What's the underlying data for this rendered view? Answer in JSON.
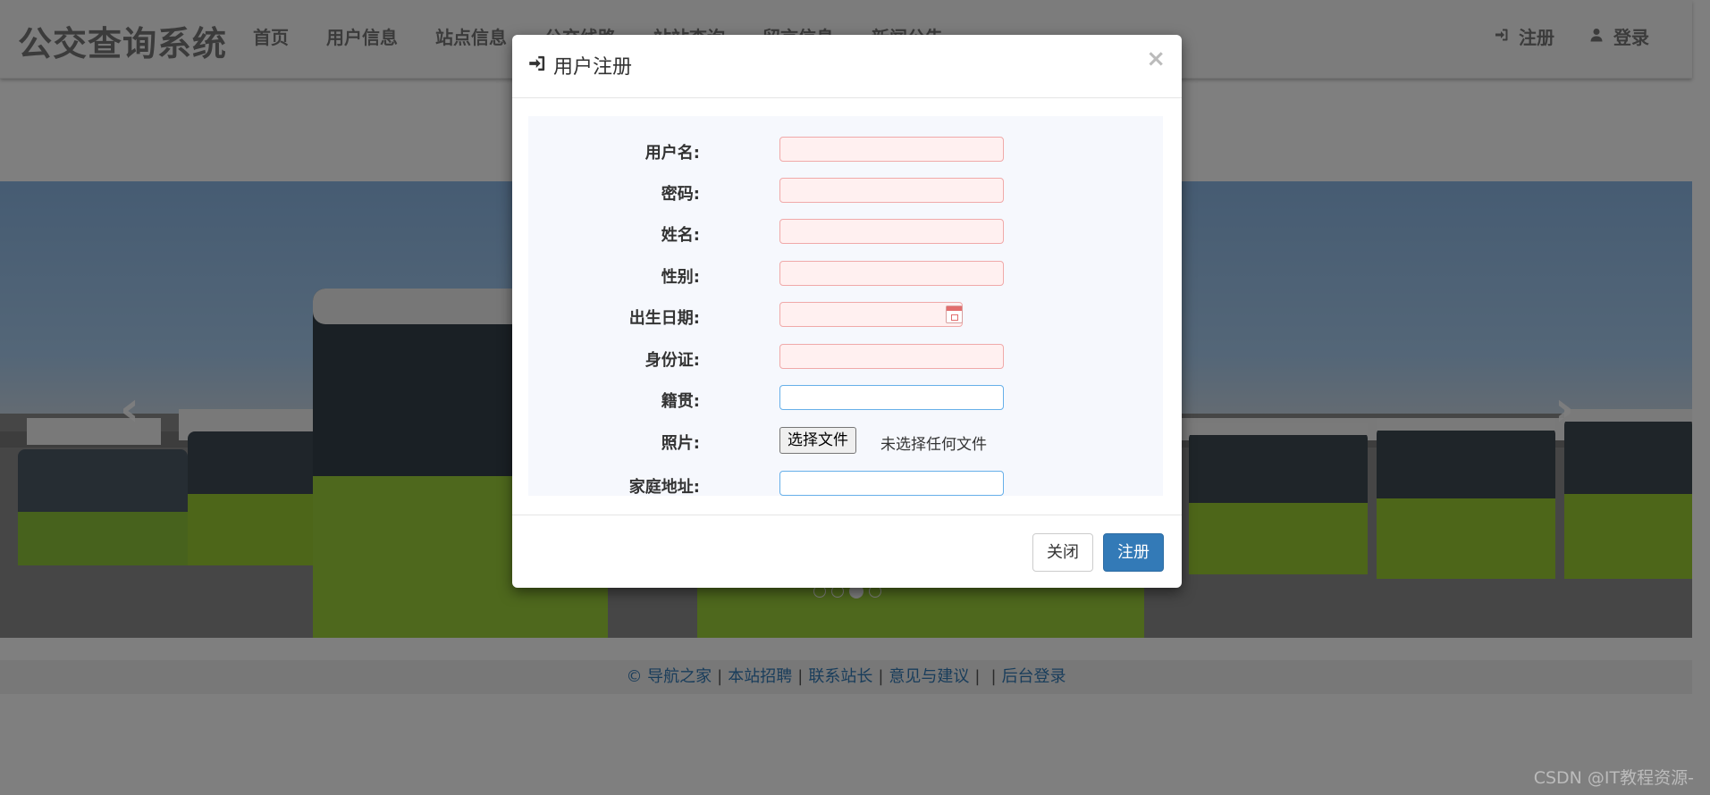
{
  "navbar": {
    "brand": "公交查询系统",
    "items": [
      "首页",
      "用户信息",
      "站点信息",
      "公交线路",
      "站站查询",
      "留言信息",
      "新闻公告"
    ],
    "register": "注册",
    "login": "登录"
  },
  "carousel": {
    "prev_glyph": "‹",
    "next_glyph": "›",
    "indicator_count": 4,
    "active_indicator": 2
  },
  "footer": {
    "links": [
      "© 导航之家",
      "本站招聘",
      "联系站长",
      "意见与建议",
      "",
      "后台登录"
    ]
  },
  "watermark": "CSDN @IT教程资源-",
  "modal": {
    "title": "用户注册",
    "close_glyph": "×",
    "fields": [
      {
        "label": "用户名:",
        "value": "",
        "state": "invalid"
      },
      {
        "label": "密码:",
        "value": "",
        "state": "invalid"
      },
      {
        "label": "姓名:",
        "value": "",
        "state": "invalid"
      },
      {
        "label": "性别:",
        "value": "",
        "state": "invalid"
      },
      {
        "label": "出生日期:",
        "value": "",
        "state": "invalid"
      },
      {
        "label": "身份证:",
        "value": "",
        "state": "invalid"
      },
      {
        "label": "籍贯:",
        "value": "",
        "state": "normal"
      },
      {
        "label": "照片:",
        "file_button": "选择文件",
        "file_status": "未选择任何文件"
      },
      {
        "label": "家庭地址:",
        "value": "",
        "state": "normal"
      }
    ],
    "close_button": "关闭",
    "submit_button": "注册"
  },
  "colors": {
    "primary": "#337ab7",
    "invalid_bg": "#fff0f0",
    "invalid_border": "#f0a9a9",
    "focus_border": "#66afe9"
  },
  "icons": {
    "title": "sign-in-icon",
    "register": "sign-in-icon",
    "login": "user-icon",
    "birthdate": "calendar-icon"
  }
}
